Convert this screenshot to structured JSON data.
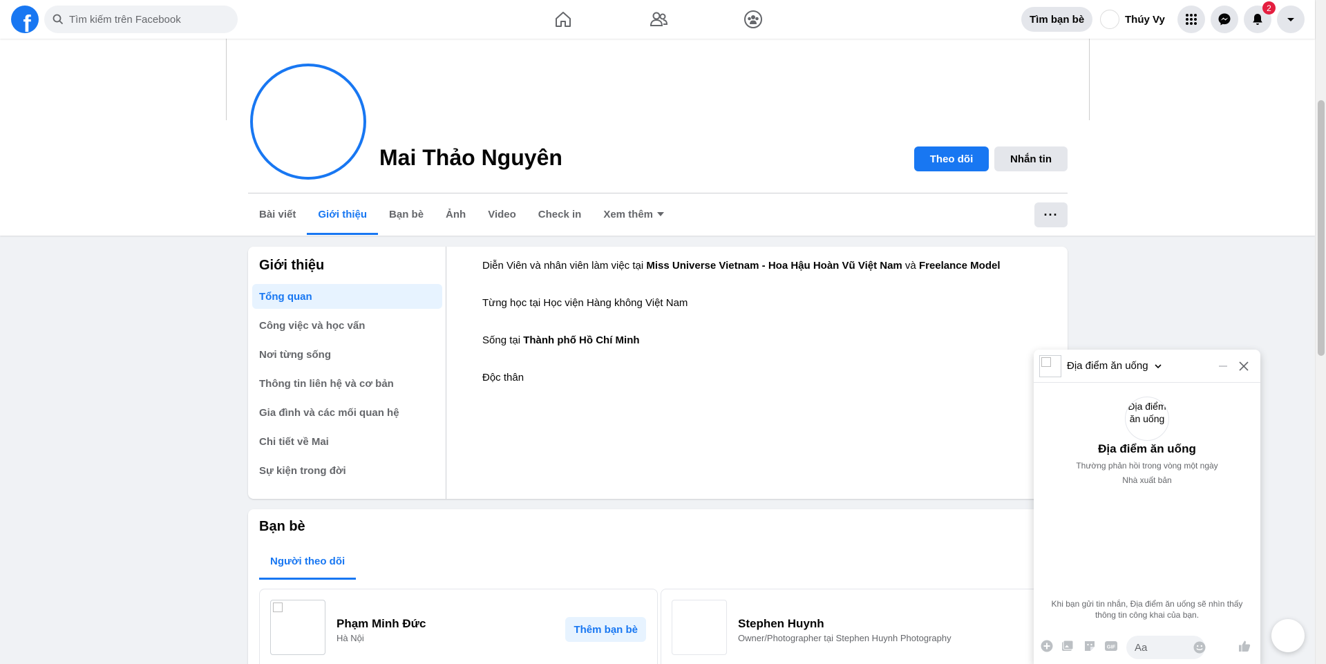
{
  "topbar": {
    "logo": "f",
    "search_placeholder": "Tìm kiếm trên Facebook",
    "find_friends": "Tìm bạn bè",
    "user_name": "Thúy Vy",
    "notifications_count": "2",
    "icons": [
      "home-icon",
      "friends-icon",
      "groups-icon",
      "menu-grid-icon",
      "messenger-icon",
      "bell-icon",
      "account-caret-icon"
    ]
  },
  "profile": {
    "name": "Mai Thảo Nguyên",
    "follow_label": "Theo dõi",
    "message_label": "Nhắn tin",
    "tabs": [
      {
        "label": "Bài viết"
      },
      {
        "label": "Giới thiệu",
        "active": true
      },
      {
        "label": "Bạn bè"
      },
      {
        "label": "Ảnh"
      },
      {
        "label": "Video"
      },
      {
        "label": "Check in"
      },
      {
        "label": "Xem thêm"
      }
    ],
    "more_button": "···"
  },
  "about": {
    "title": "Giới thiệu",
    "menu": [
      "Tổng quan",
      "Công việc và học vấn",
      "Nơi từng sống",
      "Thông tin liên hệ và cơ bản",
      "Gia đình và các mối quan hệ",
      "Chi tiết về Mai",
      "Sự kiện trong đời"
    ],
    "work_prefix": "Diễn Viên và nhân viên làm việc tại ",
    "work_place_1": "Miss Universe Vietnam - Hoa Hậu Hoàn Vũ Việt Nam",
    "work_and": " và ",
    "work_place_2": "Freelance Model",
    "study": "Từng học tại Học viện Hàng không Việt Nam",
    "lives_prefix": "Sống tại ",
    "lives_city": "Thành phố Hồ Chí Minh",
    "relationship": "Độc thân"
  },
  "friends": {
    "title": "Bạn bè",
    "tab": "Người theo dõi",
    "items": [
      {
        "name": "Phạm Minh Đức",
        "sub": "Hà Nội",
        "action": "Thêm bạn bè"
      },
      {
        "name": "Stephen Huynh",
        "sub": "Owner/Photographer tại Stephen Huynh Photography"
      }
    ]
  },
  "chat": {
    "name": "Địa điểm ăn uống",
    "avatar_alt": "Địa điểm ăn uống",
    "title": "Địa điểm ăn uống",
    "reply_time": "Thường phản hồi trong vòng một ngày",
    "role": "Nhà xuất bản",
    "note": "Khi bạn gửi tin nhắn, Địa điểm ăn uống sẽ nhìn thấy thông tin công khai của bạn.",
    "input_placeholder": "Aa",
    "gif_label": "GIF"
  },
  "colors": {
    "brand": "#1877f2",
    "badge": "#e41e3f",
    "page_bg": "#f0f2f5"
  }
}
